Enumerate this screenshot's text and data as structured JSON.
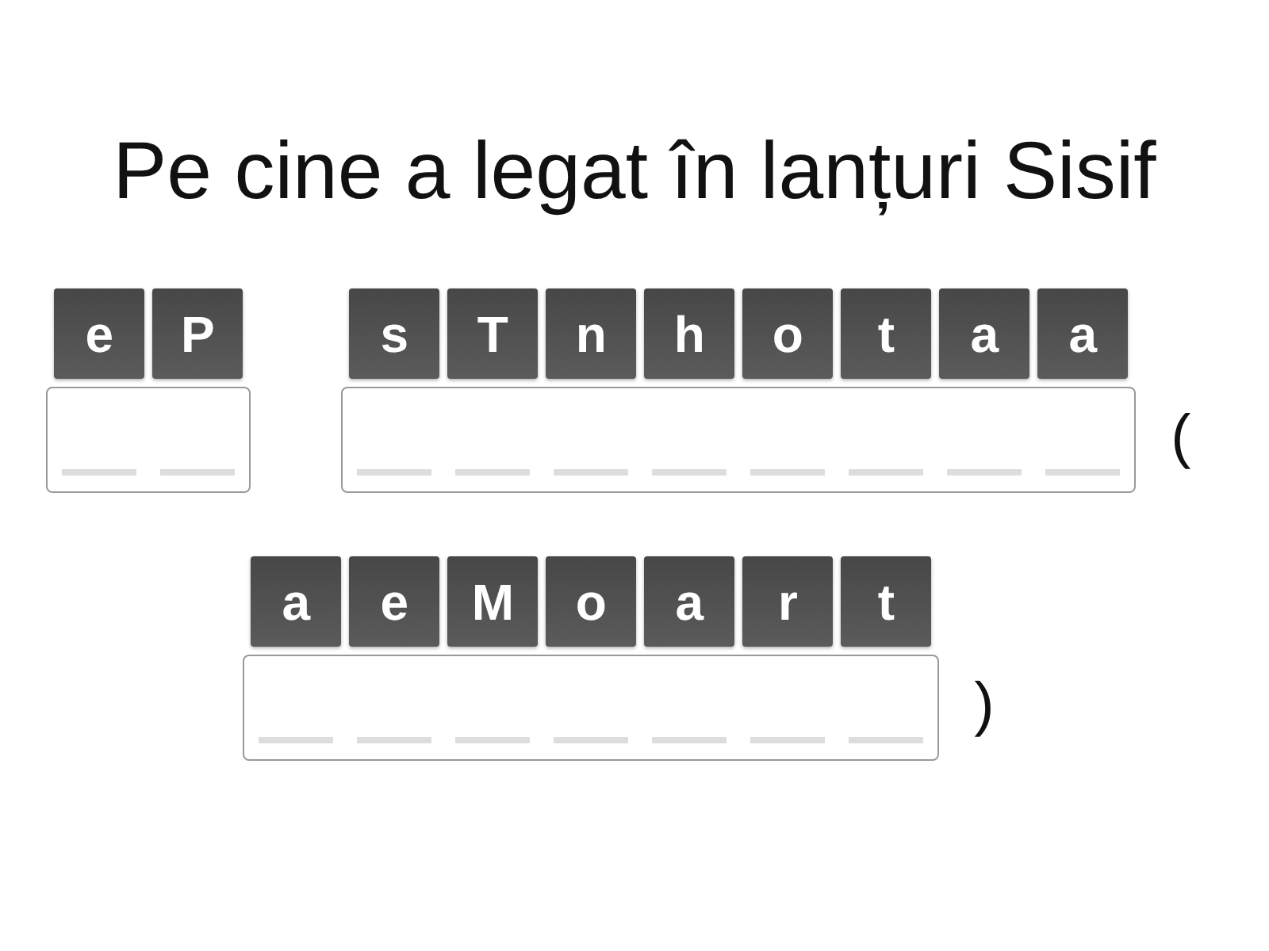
{
  "title": "Pe cine a legat în lanțuri Sisif",
  "lines": [
    {
      "words": [
        {
          "tiles": [
            "e",
            "P"
          ]
        },
        {
          "tiles": [
            "s",
            "T",
            "n",
            "h",
            "o",
            "t",
            "a",
            "a"
          ],
          "after": "("
        }
      ]
    },
    {
      "words": [
        {
          "tiles": [
            "a",
            "e",
            "M",
            "o",
            "a",
            "r",
            "t"
          ],
          "after": ")"
        }
      ]
    }
  ]
}
